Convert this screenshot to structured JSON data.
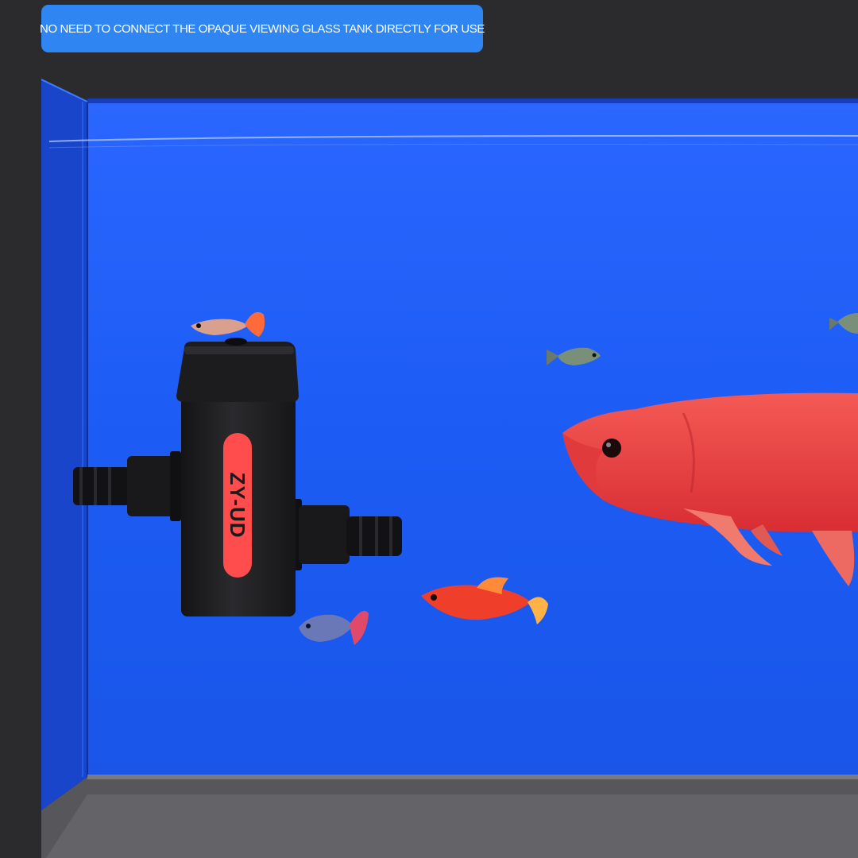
{
  "banner": {
    "text": "NO NEED TO CONNECT THE OPAQUE VIEWING GLASS TANK DIRECTLY FOR USE"
  },
  "device": {
    "label": "ZY-UD",
    "label_color": "#ff4d4d",
    "body_color": "#1f1f21"
  },
  "colors": {
    "water": "#1f5ff5",
    "arowana": "#ef3d3d",
    "banner": "#2f86f2",
    "frame": "#2b2b2d"
  }
}
